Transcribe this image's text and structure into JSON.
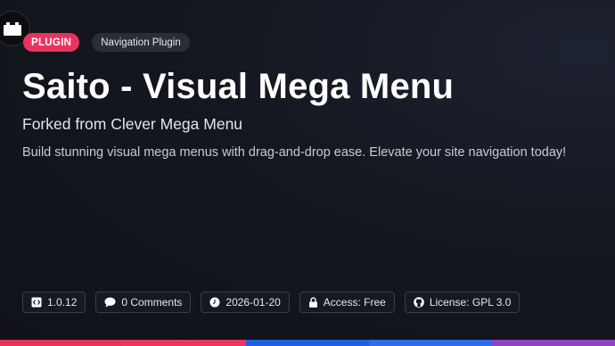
{
  "header": {
    "type_badge": "PLUGIN",
    "category_badge": "Navigation Plugin"
  },
  "main": {
    "title": "Saito - Visual Mega Menu",
    "subtitle": "Forked from Clever Mega Menu",
    "description": "Build stunning visual mega menus with drag-and-drop ease. Elevate your site navigation today!"
  },
  "meta": [
    {
      "icon": "code-icon",
      "label": "1.0.12"
    },
    {
      "icon": "comment-icon",
      "label": "0 Comments"
    },
    {
      "icon": "clock-icon",
      "label": "2026-01-20"
    },
    {
      "icon": "lock-icon",
      "label": "Access: Free"
    },
    {
      "icon": "github-icon",
      "label": "License: GPL 3.0"
    }
  ],
  "colors": {
    "badge_accent": "#e8335c",
    "bar": [
      "#e8335c",
      "#f0345e",
      "#1f5fe0",
      "#2f6de8",
      "#8e44c4"
    ]
  }
}
